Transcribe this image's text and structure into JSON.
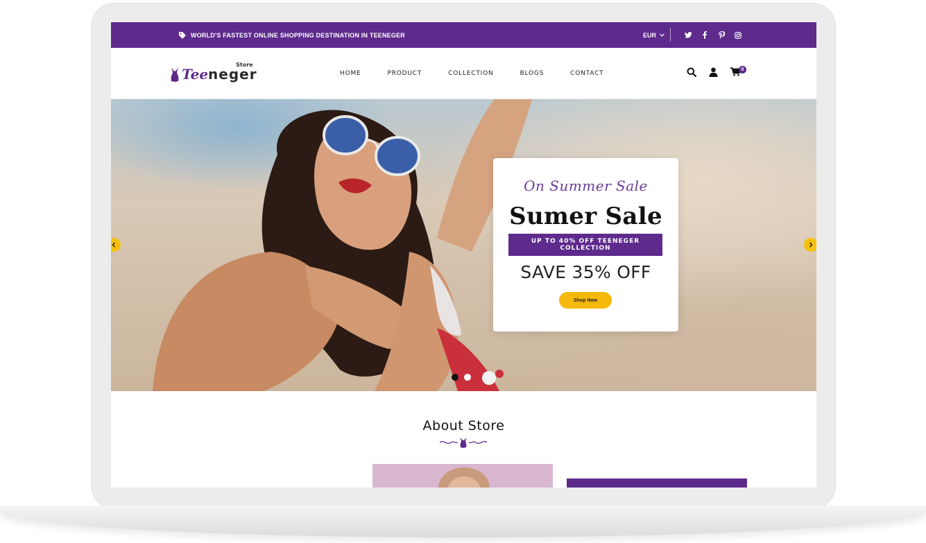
{
  "topbar": {
    "promo_text": "WORLD'S FASTEST ONLINE SHOPPING DESTINATION IN TEENEGER",
    "currency": "EUR",
    "socials": [
      "twitter-icon",
      "facebook-icon",
      "pinterest-icon",
      "instagram-icon"
    ]
  },
  "brand": {
    "name_part1": "Tee",
    "name_part2": "neger",
    "tagline": "Store"
  },
  "nav": {
    "items": [
      {
        "label": "HOME"
      },
      {
        "label": "PRODUCT"
      },
      {
        "label": "COLLECTION"
      },
      {
        "label": "BLOGS"
      },
      {
        "label": "CONTACT"
      }
    ],
    "cart_count": "0"
  },
  "hero": {
    "script_text": "On Summer Sale",
    "title": "Sumer Sale",
    "band": "UP TO 40% OFF TEENEGER COLLECTION",
    "save": "SAVE 35% OFF",
    "button": "Shop Now",
    "slide_count": 2,
    "active_slide": 1
  },
  "about": {
    "title": "About Store"
  },
  "colors": {
    "brand_purple": "#5e2a8c",
    "accent_yellow": "#f5b80c"
  }
}
